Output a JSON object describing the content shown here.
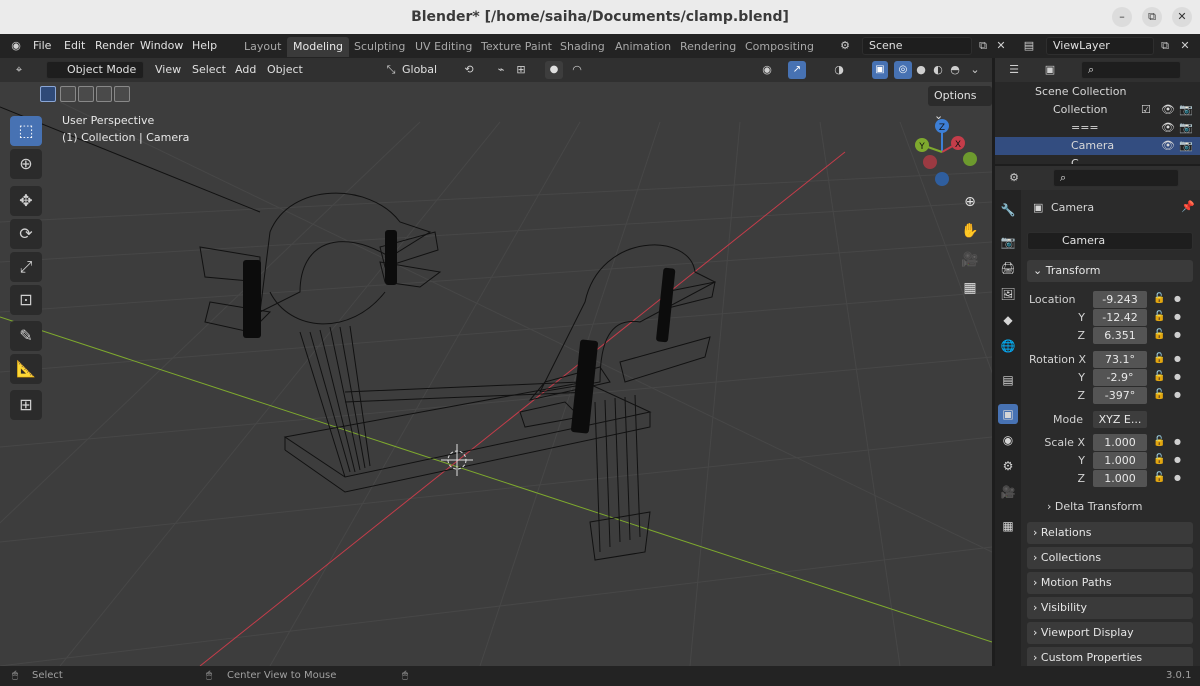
{
  "window": {
    "title": "Blender* [/home/saiha/Documents/clamp.blend]",
    "min": "–",
    "max": "⧉",
    "close": "✕"
  },
  "menu": [
    "File",
    "Edit",
    "Render",
    "Window",
    "Help"
  ],
  "workspaces": [
    "Layout",
    "Modeling",
    "Sculpting",
    "UV Editing",
    "Texture Paint",
    "Shading",
    "Animation",
    "Rendering",
    "Compositing"
  ],
  "active_workspace": "Modeling",
  "scene": {
    "name": "Scene",
    "view_layer": "ViewLayer"
  },
  "viewport_header": {
    "mode": "Object Mode",
    "menus": [
      "View",
      "Select",
      "Add",
      "Object"
    ],
    "transform_orientation": "Global",
    "options": "Options"
  },
  "viewport": {
    "perspective": "User Perspective",
    "collection_info": "(1) Collection | Camera",
    "gizmo": {
      "z": "Z",
      "x": "X",
      "y": "Y"
    }
  },
  "outliner": {
    "root": "Scene Collection",
    "items": [
      {
        "label": "Collection"
      },
      {
        "label": "==="
      },
      {
        "label": "Camera",
        "selected": true
      },
      {
        "label": "C..."
      }
    ]
  },
  "properties": {
    "object_name": "Camera",
    "data_name": "Camera",
    "transform": {
      "header": "Transform",
      "location_label": "Location",
      "location": {
        "x": "-9.243",
        "y": "-12.42",
        "z": "6.351"
      },
      "rotation_label": "Rotation X",
      "rotation": {
        "x": "73.1°",
        "y": "-2.9°",
        "z": "-397°"
      },
      "mode_label": "Mode",
      "mode": "XYZ E...",
      "scale_label": "Scale X",
      "scale": {
        "x": "1.000",
        "y": "1.000",
        "z": "1.000"
      },
      "axis_y": "Y",
      "axis_z": "Z",
      "delta": "Delta Transform"
    },
    "panels": [
      "Relations",
      "Collections",
      "Motion Paths",
      "Visibility",
      "Viewport Display",
      "Custom Properties"
    ]
  },
  "statusbar": {
    "select": "Select",
    "center": "Center View to Mouse",
    "version": "3.0.1"
  },
  "colors": {
    "accent": "#4772b3",
    "x_axis": "#c43d4a",
    "y_axis": "#7ea92e",
    "z_axis": "#3d7fd6"
  }
}
